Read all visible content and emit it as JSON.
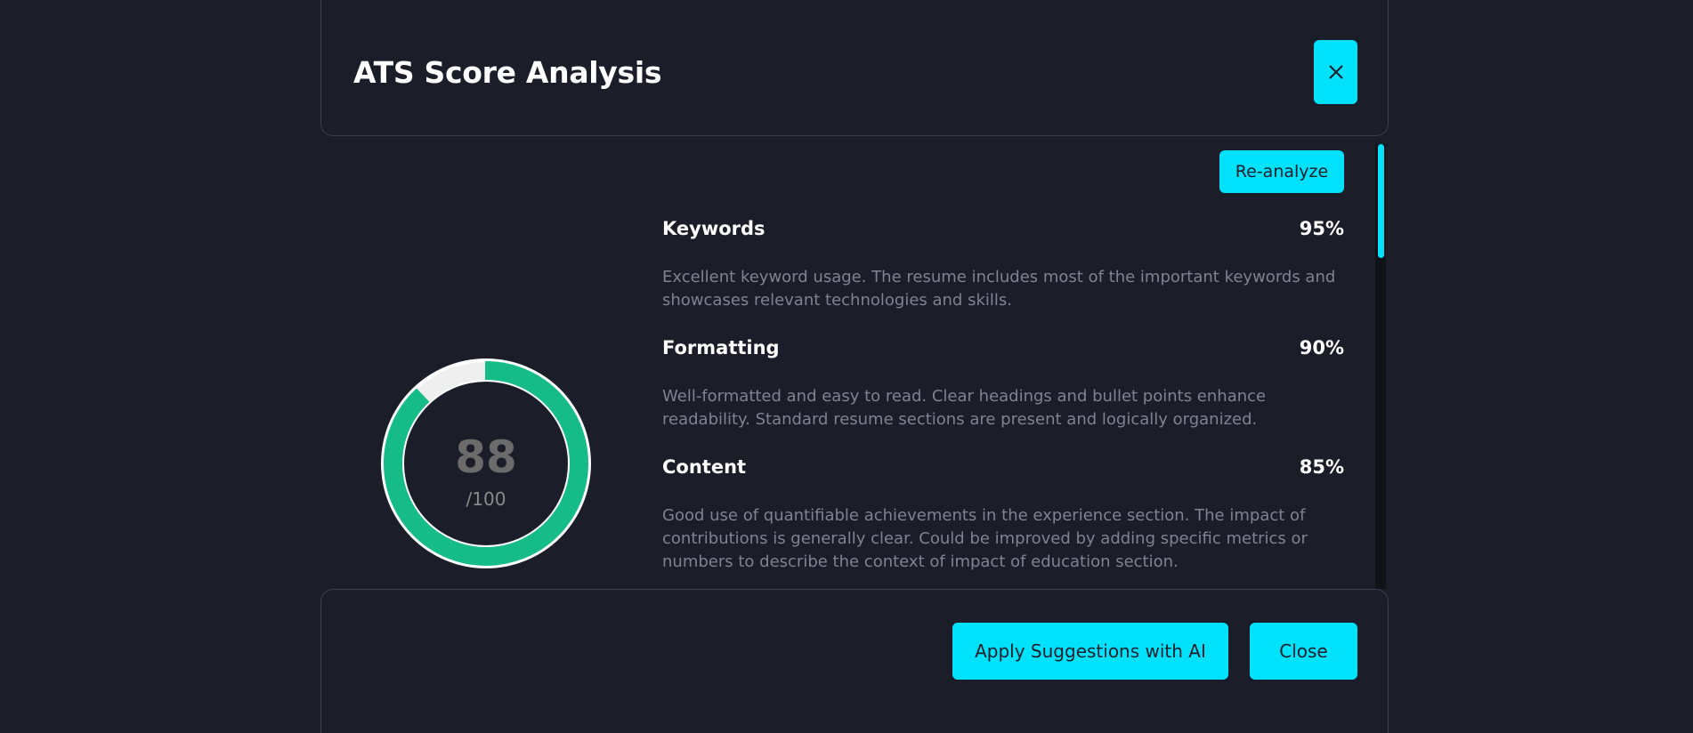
{
  "modal": {
    "title": "ATS Score Analysis",
    "close_icon": "close-icon"
  },
  "score": {
    "value": "88",
    "total": "/100",
    "fraction": 0.88,
    "ring_color": "#16bc87",
    "track_color": "#efefef"
  },
  "reanalyze_label": "Re-analyze",
  "categories": [
    {
      "name": "Keywords",
      "score": "95%",
      "description": "Excellent keyword usage. The resume includes most of the important keywords and showcases relevant technologies and skills."
    },
    {
      "name": "Formatting",
      "score": "90%",
      "description": "Well-formatted and easy to read. Clear headings and bullet points enhance readability. Standard resume sections are present and logically organized."
    },
    {
      "name": "Content",
      "score": "85%",
      "description": "Good use of quantifiable achievements in the experience section. The impact of contributions is generally clear. Could be improved by adding specific metrics or numbers to describe the context of impact of education section."
    }
  ],
  "footer": {
    "apply_label": "Apply Suggestions with AI",
    "close_label": "Close"
  },
  "colors": {
    "accent": "#00e1fc",
    "background": "#1b1d29"
  }
}
